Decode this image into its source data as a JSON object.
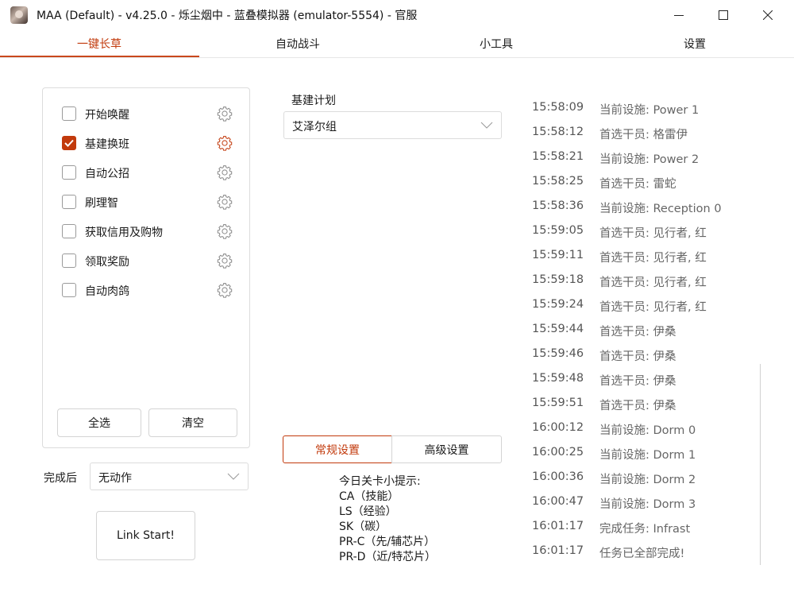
{
  "window": {
    "title": "MAA (Default) - v4.25.0 - 烁尘烟中 - 蓝叠模拟器 (emulator-5554) - 官服"
  },
  "tabs": [
    {
      "label": "一键长草",
      "active": true
    },
    {
      "label": "自动战斗",
      "active": false
    },
    {
      "label": "小工具",
      "active": false
    },
    {
      "label": "设置",
      "active": false
    }
  ],
  "tasks": [
    {
      "label": "开始唤醒",
      "checked": false
    },
    {
      "label": "基建换班",
      "checked": true
    },
    {
      "label": "自动公招",
      "checked": false
    },
    {
      "label": "刷理智",
      "checked": false
    },
    {
      "label": "获取信用及购物",
      "checked": false
    },
    {
      "label": "领取奖励",
      "checked": false
    },
    {
      "label": "自动肉鸽",
      "checked": false
    }
  ],
  "task_buttons": {
    "select_all": "全选",
    "clear": "清空"
  },
  "after_complete": {
    "label": "完成后",
    "value": "无动作"
  },
  "link_start": "Link Start!",
  "infrast": {
    "plan_label": "基建计划",
    "plan_value": "艾泽尔组"
  },
  "settings_tabs": {
    "normal": "常规设置",
    "advanced": "高级设置"
  },
  "tips": {
    "title": "今日关卡小提示:",
    "lines": [
      "CA（技能）",
      "LS（经验）",
      "SK（碳）",
      "PR-C（先/辅芯片）",
      "PR-D（近/特芯片）"
    ]
  },
  "log": [
    {
      "time": "15:58:09",
      "msg": "当前设施: Power 1"
    },
    {
      "time": "15:58:12",
      "msg": "首选干员: 格雷伊"
    },
    {
      "time": "15:58:21",
      "msg": "当前设施: Power 2"
    },
    {
      "time": "15:58:25",
      "msg": "首选干员: 雷蛇"
    },
    {
      "time": "15:58:36",
      "msg": "当前设施: Reception 0"
    },
    {
      "time": "15:59:05",
      "msg": "首选干员: 见行者, 红"
    },
    {
      "time": "15:59:11",
      "msg": "首选干员: 见行者, 红"
    },
    {
      "time": "15:59:18",
      "msg": "首选干员: 见行者, 红"
    },
    {
      "time": "15:59:24",
      "msg": "首选干员: 见行者, 红"
    },
    {
      "time": "15:59:44",
      "msg": "首选干员: 伊桑"
    },
    {
      "time": "15:59:46",
      "msg": "首选干员: 伊桑"
    },
    {
      "time": "15:59:48",
      "msg": "首选干员: 伊桑"
    },
    {
      "time": "15:59:51",
      "msg": "首选干员: 伊桑"
    },
    {
      "time": "16:00:12",
      "msg": "当前设施: Dorm 0"
    },
    {
      "time": "16:00:25",
      "msg": "当前设施: Dorm 1"
    },
    {
      "time": "16:00:36",
      "msg": "当前设施: Dorm 2"
    },
    {
      "time": "16:00:47",
      "msg": "当前设施: Dorm 3"
    },
    {
      "time": "16:01:17",
      "msg": "完成任务: Infrast"
    },
    {
      "time": "16:01:17",
      "msg": "任务已全部完成!"
    }
  ],
  "colors": {
    "accent": "#c23a0c"
  }
}
